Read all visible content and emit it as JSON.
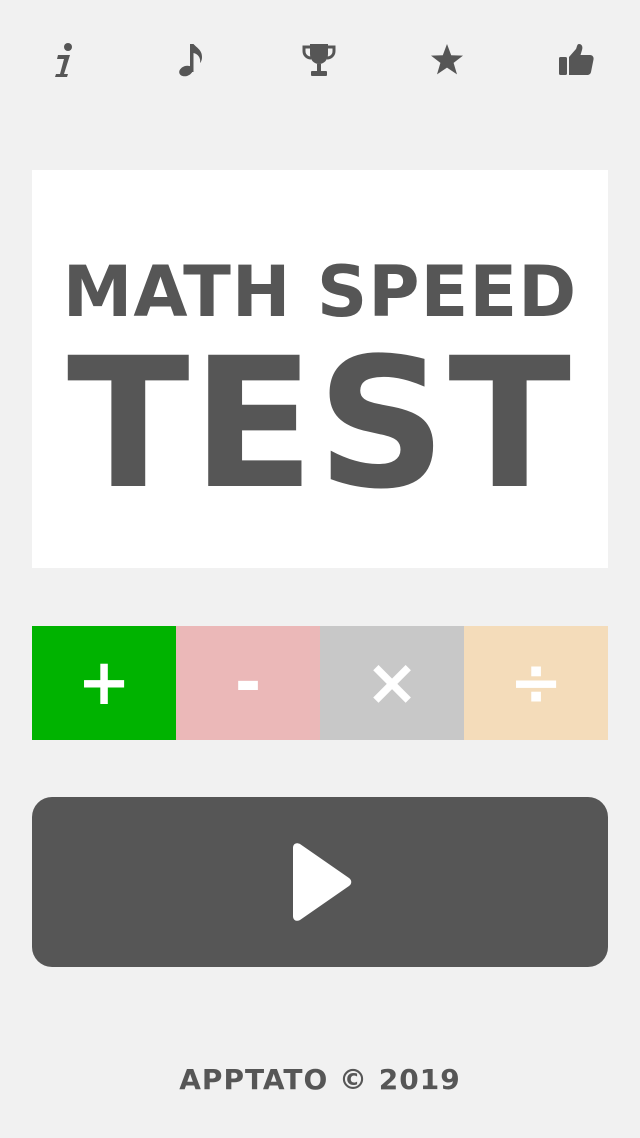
{
  "toolbar": {
    "icons": [
      "info-icon",
      "music-note-icon",
      "trophy-icon",
      "star-icon",
      "thumbs-up-icon"
    ]
  },
  "title": {
    "line1": "MATH SPEED",
    "line2": "TEST"
  },
  "operations": [
    {
      "symbol": "+",
      "name": "addition",
      "color": "#00b300",
      "selected": true
    },
    {
      "symbol": "-",
      "name": "subtraction",
      "color": "#ebb8b8",
      "selected": false
    },
    {
      "symbol": "×",
      "name": "multiplication",
      "color": "#c8c8c8",
      "selected": false
    },
    {
      "symbol": "÷",
      "name": "division",
      "color": "#f4dcba",
      "selected": false
    }
  ],
  "play": {
    "icon": "play-icon"
  },
  "footer": {
    "text": "APPTATO © 2019"
  },
  "colors": {
    "background": "#f1f1f1",
    "card": "#ffffff",
    "dark": "#565656"
  }
}
